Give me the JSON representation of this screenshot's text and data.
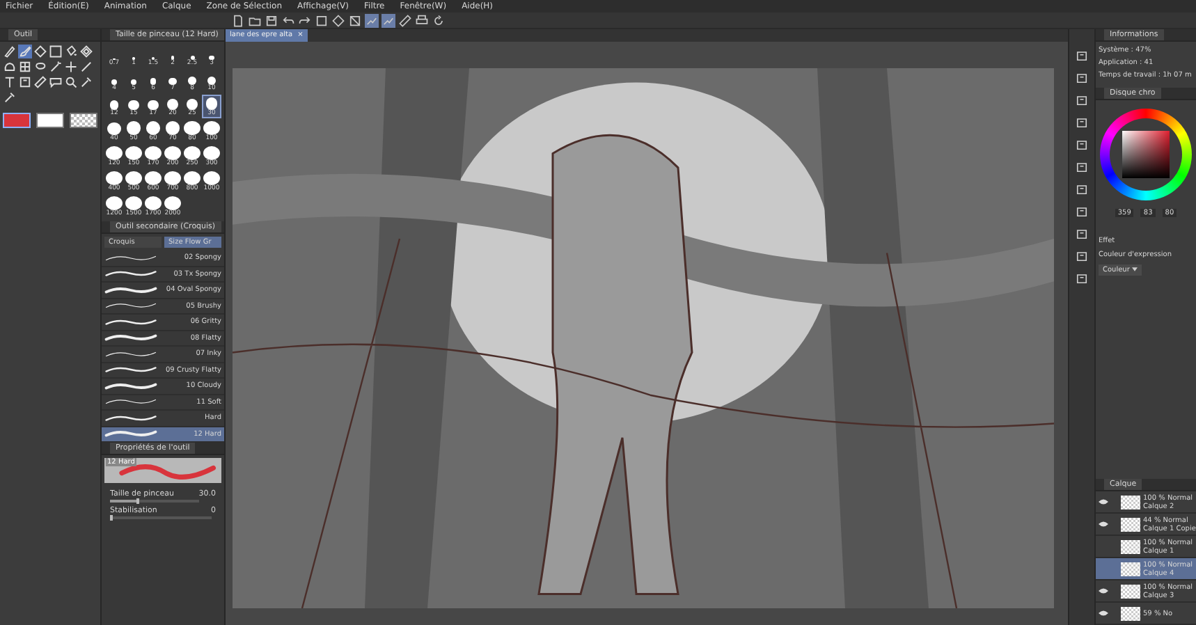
{
  "menu": [
    "Fichier",
    "Édition(E)",
    "Animation",
    "Calque",
    "Zone de Sélection",
    "Affichage(V)",
    "Filtre",
    "Fenêtre(W)",
    "Aide(H)"
  ],
  "toolbar": {
    "buttons": [
      {
        "kind": "new",
        "selected": false
      },
      {
        "kind": "open",
        "selected": false
      },
      {
        "kind": "save",
        "selected": false
      },
      {
        "kind": "undo",
        "selected": false
      },
      {
        "kind": "redo",
        "selected": false
      },
      {
        "kind": "clear",
        "selected": false
      },
      {
        "kind": "fill",
        "selected": false
      },
      {
        "kind": "transform",
        "selected": false
      },
      {
        "kind": "snap",
        "selected": true
      },
      {
        "kind": "snap",
        "selected": true
      },
      {
        "kind": "ruler",
        "selected": false
      },
      {
        "kind": "print",
        "selected": false
      },
      {
        "kind": "rotate",
        "selected": false
      }
    ]
  },
  "tool_panel": {
    "title": "Outil",
    "tools": [
      {
        "kind": "pen",
        "selected": false
      },
      {
        "kind": "brush",
        "selected": true
      },
      {
        "kind": "fill",
        "selected": false
      },
      {
        "kind": "gradient",
        "selected": false
      },
      {
        "kind": "bucket",
        "selected": false
      },
      {
        "kind": "pattern",
        "selected": false
      },
      {
        "kind": "blob",
        "selected": false
      },
      {
        "kind": "grid",
        "selected": false
      },
      {
        "kind": "lasso",
        "selected": false
      },
      {
        "kind": "wand",
        "selected": false
      },
      {
        "kind": "move",
        "selected": false
      },
      {
        "kind": "line",
        "selected": false
      },
      {
        "kind": "text",
        "selected": false
      },
      {
        "kind": "frame",
        "selected": false
      },
      {
        "kind": "ruler",
        "selected": false
      },
      {
        "kind": "balloon",
        "selected": false
      },
      {
        "kind": "zoom",
        "selected": false
      },
      {
        "kind": "eyedropper",
        "selected": false
      },
      {
        "kind": "eyedropper",
        "selected": false
      }
    ],
    "swatches": [
      {
        "kind": "color",
        "color": "#d8343c",
        "selected": true
      },
      {
        "kind": "color",
        "color": "#ffffff",
        "selected": false
      },
      {
        "kind": "transparent",
        "selected": false
      }
    ]
  },
  "brush_size": {
    "title": "Taille de pinceau (12 Hard)",
    "sizes": [
      {
        "label": "0.7",
        "selected": false
      },
      {
        "label": "1",
        "selected": false
      },
      {
        "label": "1.5",
        "selected": false
      },
      {
        "label": "2",
        "selected": false
      },
      {
        "label": "2.5",
        "selected": false
      },
      {
        "label": "3",
        "selected": false
      },
      {
        "label": "4",
        "selected": false
      },
      {
        "label": "5",
        "selected": false
      },
      {
        "label": "6",
        "selected": false
      },
      {
        "label": "7",
        "selected": false
      },
      {
        "label": "8",
        "selected": false
      },
      {
        "label": "10",
        "selected": false
      },
      {
        "label": "12",
        "selected": false
      },
      {
        "label": "15",
        "selected": false
      },
      {
        "label": "17",
        "selected": false
      },
      {
        "label": "20",
        "selected": false
      },
      {
        "label": "25",
        "selected": false
      },
      {
        "label": "30",
        "selected": true
      },
      {
        "label": "40",
        "selected": false
      },
      {
        "label": "50",
        "selected": false
      },
      {
        "label": "60",
        "selected": false
      },
      {
        "label": "70",
        "selected": false
      },
      {
        "label": "80",
        "selected": false
      },
      {
        "label": "100",
        "selected": false
      },
      {
        "label": "120",
        "selected": false
      },
      {
        "label": "150",
        "selected": false
      },
      {
        "label": "170",
        "selected": false
      },
      {
        "label": "200",
        "selected": false
      },
      {
        "label": "250",
        "selected": false
      },
      {
        "label": "300",
        "selected": false
      },
      {
        "label": "400",
        "selected": false
      },
      {
        "label": "500",
        "selected": false
      },
      {
        "label": "600",
        "selected": false
      },
      {
        "label": "700",
        "selected": false
      },
      {
        "label": "800",
        "selected": false
      },
      {
        "label": "1000",
        "selected": false
      },
      {
        "label": "1200",
        "selected": false
      },
      {
        "label": "1500",
        "selected": false
      },
      {
        "label": "1700",
        "selected": false
      },
      {
        "label": "2000",
        "selected": false
      }
    ]
  },
  "sub_tool": {
    "title": "Outil secondaire (Croquis)",
    "tabs": [
      {
        "label": "Croquis",
        "selected": false
      },
      {
        "label": "Size Flow Gr",
        "selected": true
      }
    ],
    "brushes": [
      {
        "name": "02 Spongy",
        "selected": false
      },
      {
        "name": "03 Tx Spongy",
        "selected": false
      },
      {
        "name": "04 Oval Spongy",
        "selected": false
      },
      {
        "name": "05 Brushy",
        "selected": false
      },
      {
        "name": "06 Gritty",
        "selected": false
      },
      {
        "name": "08 Flatty",
        "selected": false
      },
      {
        "name": "07 Inky",
        "selected": false
      },
      {
        "name": "09 Crusty Flatty",
        "selected": false
      },
      {
        "name": "10 Cloudy",
        "selected": false
      },
      {
        "name": "11 Soft",
        "selected": false
      },
      {
        "name": "Hard",
        "selected": false
      },
      {
        "name": "12 Hard",
        "selected": true
      }
    ]
  },
  "tool_property": {
    "title": "Propriétés de l'outil",
    "preview_label": "12 Hard",
    "settings": [
      {
        "label": "Taille de pinceau",
        "value": "30.0",
        "level": 0.3
      },
      {
        "label": "Stabilisation",
        "value": "0",
        "level": 0
      }
    ]
  },
  "document_tab": {
    "title": "lane des epre alta",
    "close": "×"
  },
  "info_panel": {
    "title": "Informations",
    "system": "Système : 47%",
    "application": "Application : 41",
    "work_time": "Temps de travail : 1h 07 m"
  },
  "color_panel": {
    "title": "Disque chro",
    "hue": "359",
    "saturation": "83",
    "value": "80"
  },
  "effect_panel": {
    "title": "Effet",
    "expression_label": "Couleur d'expression",
    "expression_value": "Couleur"
  },
  "layer_panel": {
    "title": "Calque",
    "layers": [
      {
        "mode": "100 % Normal",
        "name": "Calque 2",
        "visible": true,
        "selected": false
      },
      {
        "mode": "44 % Normal",
        "name": "Calque 1 Copie",
        "visible": true,
        "selected": false
      },
      {
        "mode": "100 % Normal",
        "name": "Calque 1",
        "visible": false,
        "selected": false
      },
      {
        "mode": "100 % Normal",
        "name": "Calque 4",
        "visible": false,
        "selected": true
      },
      {
        "mode": "100 % Normal",
        "name": "Calque 3",
        "visible": true,
        "selected": false
      },
      {
        "mode": "59 % No",
        "visible": true,
        "selected": false
      }
    ]
  }
}
